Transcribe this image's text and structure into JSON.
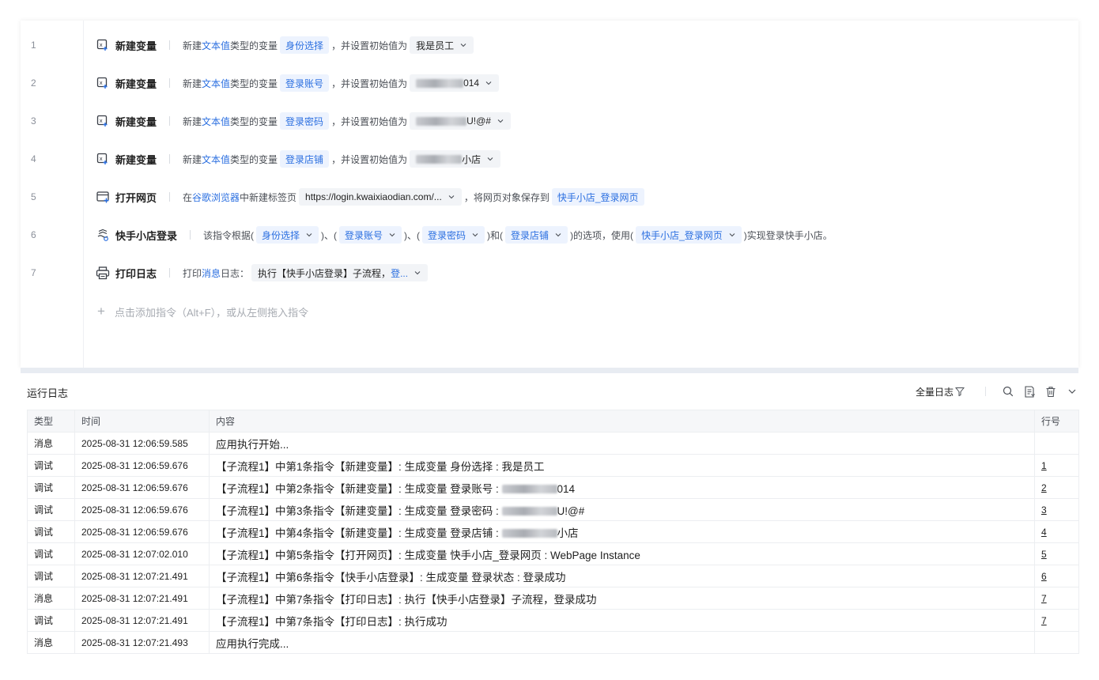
{
  "editor": {
    "rows": [
      {
        "no": "1",
        "title": "新建变量",
        "pre": "新建",
        "kw": "文本值",
        "mid": "类型的变量",
        "var": "身份选择",
        "post": "，并设置初始值为",
        "value": "我是员工"
      },
      {
        "no": "2",
        "title": "新建变量",
        "pre": "新建",
        "kw": "文本值",
        "mid": "类型的变量",
        "var": "登录账号",
        "post": "，并设置初始值为",
        "value": "014"
      },
      {
        "no": "3",
        "title": "新建变量",
        "pre": "新建",
        "kw": "文本值",
        "mid": "类型的变量",
        "var": "登录密码",
        "post": "，并设置初始值为",
        "value": "U!@#"
      },
      {
        "no": "4",
        "title": "新建变量",
        "pre": "新建",
        "kw": "文本值",
        "mid": "类型的变量",
        "var": "登录店铺",
        "post": "，并设置初始值为",
        "value": "小店"
      }
    ],
    "row5": {
      "no": "5",
      "title": "打开网页",
      "pre": "在",
      "kw": "谷歌浏览器",
      "mid": "中新建标签页",
      "url": "https://login.kwaixiaodian.com/...",
      "post": "，将网页对象保存到",
      "var": "快手小店_登录网页"
    },
    "row6": {
      "no": "6",
      "title": "快手小店登录",
      "pre": "该指令根据(",
      "p1": "身份选择",
      "s1": ")、(",
      "p2": "登录账号",
      "s2": ")、(",
      "p3": "登录密码",
      "s3": ")和(",
      "p4": "登录店铺",
      "s4": ")的选项，使用(",
      "p5": "快手小店_登录网页",
      "post": ")实现登录快手小店。"
    },
    "row7": {
      "no": "7",
      "title": "打印日志",
      "pre": "打印",
      "kw": "消息",
      "mid": "日志：",
      "msg": "执行【快手小店登录】子流程，",
      "msg_tag": "登..."
    },
    "add_hint": "点击添加指令（Alt+F），或从左侧拖入指令"
  },
  "log": {
    "title": "运行日志",
    "filter_label": "全量日志",
    "columns": [
      "类型",
      "时间",
      "内容",
      "行号"
    ],
    "rows": [
      {
        "type": "消息",
        "time": "2025-08-31 12:06:59.585",
        "content": "应用执行开始...",
        "line": ""
      },
      {
        "type": "调试",
        "time": "2025-08-31 12:06:59.676",
        "content": "【子流程1】中第1条指令【新建变量】: 生成变量 身份选择 : 我是员工",
        "line": "1"
      },
      {
        "type": "调试",
        "time": "2025-08-31 12:06:59.676",
        "content": "【子流程1】中第2条指令【新建变量】: 生成变量 登录账号 : ",
        "blur": true,
        "tail": "014",
        "line": "2"
      },
      {
        "type": "调试",
        "time": "2025-08-31 12:06:59.676",
        "content": "【子流程1】中第3条指令【新建变量】: 生成变量 登录密码 : ",
        "blur": true,
        "tail": "U!@#",
        "line": "3"
      },
      {
        "type": "调试",
        "time": "2025-08-31 12:06:59.676",
        "content": "【子流程1】中第4条指令【新建变量】: 生成变量 登录店铺 : ",
        "blur": true,
        "tail": "小店",
        "line": "4"
      },
      {
        "type": "调试",
        "time": "2025-08-31 12:07:02.010",
        "content": "【子流程1】中第5条指令【打开网页】: 生成变量 快手小店_登录网页 : WebPage Instance",
        "line": "5"
      },
      {
        "type": "调试",
        "time": "2025-08-31 12:07:21.491",
        "content": "【子流程1】中第6条指令【快手小店登录】: 生成变量 登录状态 : 登录成功",
        "line": "6"
      },
      {
        "type": "消息",
        "time": "2025-08-31 12:07:21.491",
        "content": "【子流程1】中第7条指令【打印日志】: 执行【快手小店登录】子流程，登录成功",
        "line": "7"
      },
      {
        "type": "调试",
        "time": "2025-08-31 12:07:21.491",
        "content": "【子流程1】中第7条指令【打印日志】: 执行成功",
        "line": "7"
      },
      {
        "type": "消息",
        "time": "2025-08-31 12:07:21.493",
        "content": "应用执行完成...",
        "line": ""
      }
    ]
  },
  "icons": {
    "variable": "new-variable-icon",
    "webpage": "open-webpage-icon",
    "login": "kuaishou-login-icon",
    "print": "print-log-icon",
    "search": "search-icon",
    "export": "export-log-icon",
    "delete": "trash-icon",
    "collapse": "chevron-down-icon",
    "filter": "filter-icon"
  },
  "colors": {
    "accent": "#2b6fe0",
    "tag_bg": "#edf3fe",
    "value_bg": "#f2f4f7",
    "divider": "#e8ecf2"
  }
}
